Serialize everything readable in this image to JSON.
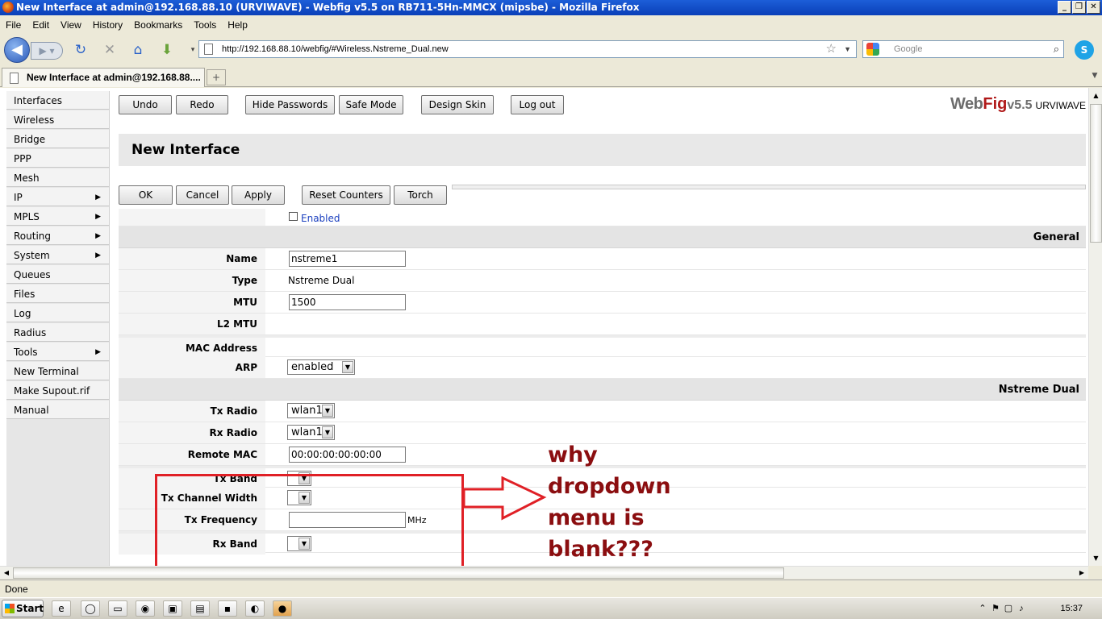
{
  "window": {
    "title": "New Interface at admin@192.168.88.10 (URVIWAVE) - Webfig v5.5 on RB711-5Hn-MMCX (mipsbe) - Mozilla Firefox"
  },
  "menu": [
    "File",
    "Edit",
    "View",
    "History",
    "Bookmarks",
    "Tools",
    "Help"
  ],
  "nav": {
    "url": "http://192.168.88.10/webfig/#Wireless.Nstreme_Dual.new",
    "search_placeholder": "Google"
  },
  "tab": {
    "label": "New Interface at admin@192.168.88....",
    "new_tab": "+"
  },
  "sidebar": {
    "items": [
      {
        "label": "Interfaces",
        "arrow": ""
      },
      {
        "label": "Wireless",
        "arrow": ""
      },
      {
        "label": "Bridge",
        "arrow": ""
      },
      {
        "label": "PPP",
        "arrow": ""
      },
      {
        "label": "Mesh",
        "arrow": ""
      },
      {
        "label": "IP",
        "arrow": "▶"
      },
      {
        "label": "MPLS",
        "arrow": "▶"
      },
      {
        "label": "Routing",
        "arrow": "▶"
      },
      {
        "label": "System",
        "arrow": "▶"
      },
      {
        "label": "Queues",
        "arrow": ""
      },
      {
        "label": "Files",
        "arrow": ""
      },
      {
        "label": "Log",
        "arrow": ""
      },
      {
        "label": "Radius",
        "arrow": ""
      },
      {
        "label": "Tools",
        "arrow": "▶"
      },
      {
        "label": "New Terminal",
        "arrow": ""
      },
      {
        "label": "Make Supout.rif",
        "arrow": ""
      },
      {
        "label": "Manual",
        "arrow": ""
      }
    ]
  },
  "toolbar": {
    "undo": "Undo",
    "redo": "Redo",
    "hide_passwords": "Hide Passwords",
    "safe_mode": "Safe Mode",
    "design_skin": "Design Skin",
    "log_out": "Log out"
  },
  "logo": {
    "web": "Web",
    "fig": "Fig",
    "version": "v5.5",
    "name": "URVIWAVE"
  },
  "page_title": "New Interface",
  "actions": {
    "ok": "OK",
    "cancel": "Cancel",
    "apply": "Apply",
    "reset_counters": "Reset Counters",
    "torch": "Torch"
  },
  "form": {
    "enabled_label": "Enabled",
    "section_general": "General",
    "name_label": "Name",
    "name_value": "nstreme1",
    "type_label": "Type",
    "type_value": "Nstreme Dual",
    "mtu_label": "MTU",
    "mtu_value": "1500",
    "l2mtu_label": "L2 MTU",
    "mac_label": "MAC Address",
    "arp_label": "ARP",
    "arp_value": "enabled",
    "section_nstreme": "Nstreme Dual",
    "tx_radio_label": "Tx Radio",
    "tx_radio_value": "wlan1",
    "rx_radio_label": "Rx Radio",
    "rx_radio_value": "wlan1",
    "remote_mac_label": "Remote MAC",
    "remote_mac_value": "00:00:00:00:00:00",
    "tx_band_label": "Tx Band",
    "tx_channel_width_label": "Tx Channel Width",
    "tx_frequency_label": "Tx Frequency",
    "tx_frequency_unit": "MHz",
    "rx_band_label": "Rx Band"
  },
  "annotation": {
    "text": "why\ndropdown\nmenu is\nblank???",
    "color": "#8b0e10",
    "box_color": "#e02026"
  },
  "status": {
    "text": "Done"
  },
  "taskbar": {
    "start": "Start",
    "clock": "15:37"
  }
}
